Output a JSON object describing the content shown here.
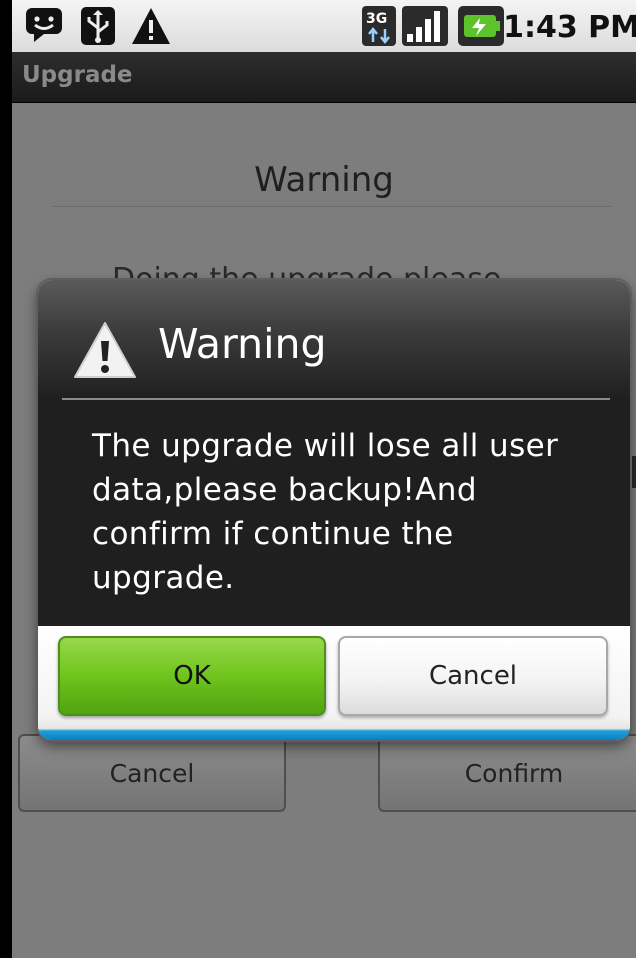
{
  "status_bar": {
    "time": "1:43 PM",
    "icons": [
      "message-icon",
      "usb-icon",
      "warning-icon",
      "3g-icon",
      "signal-icon",
      "battery-charging-icon"
    ],
    "network_label": "3G"
  },
  "app": {
    "title": "Upgrade"
  },
  "background": {
    "heading": "Warning",
    "body_partial": "Doing the upgrade please...",
    "buttons": {
      "cancel": "Cancel",
      "confirm": "Confirm"
    }
  },
  "dialog": {
    "icon": "warning-icon",
    "title": "Warning",
    "message": "The upgrade will lose all user data,please backup!And confirm if continue the upgrade.",
    "buttons": {
      "ok": "OK",
      "cancel": "Cancel"
    }
  },
  "colors": {
    "ok_button": "#6fc41d",
    "dialog_body": "#1f1f1f",
    "dialog_accent": "#0a7fc4",
    "dim_overlay": "#7d7d7d"
  }
}
